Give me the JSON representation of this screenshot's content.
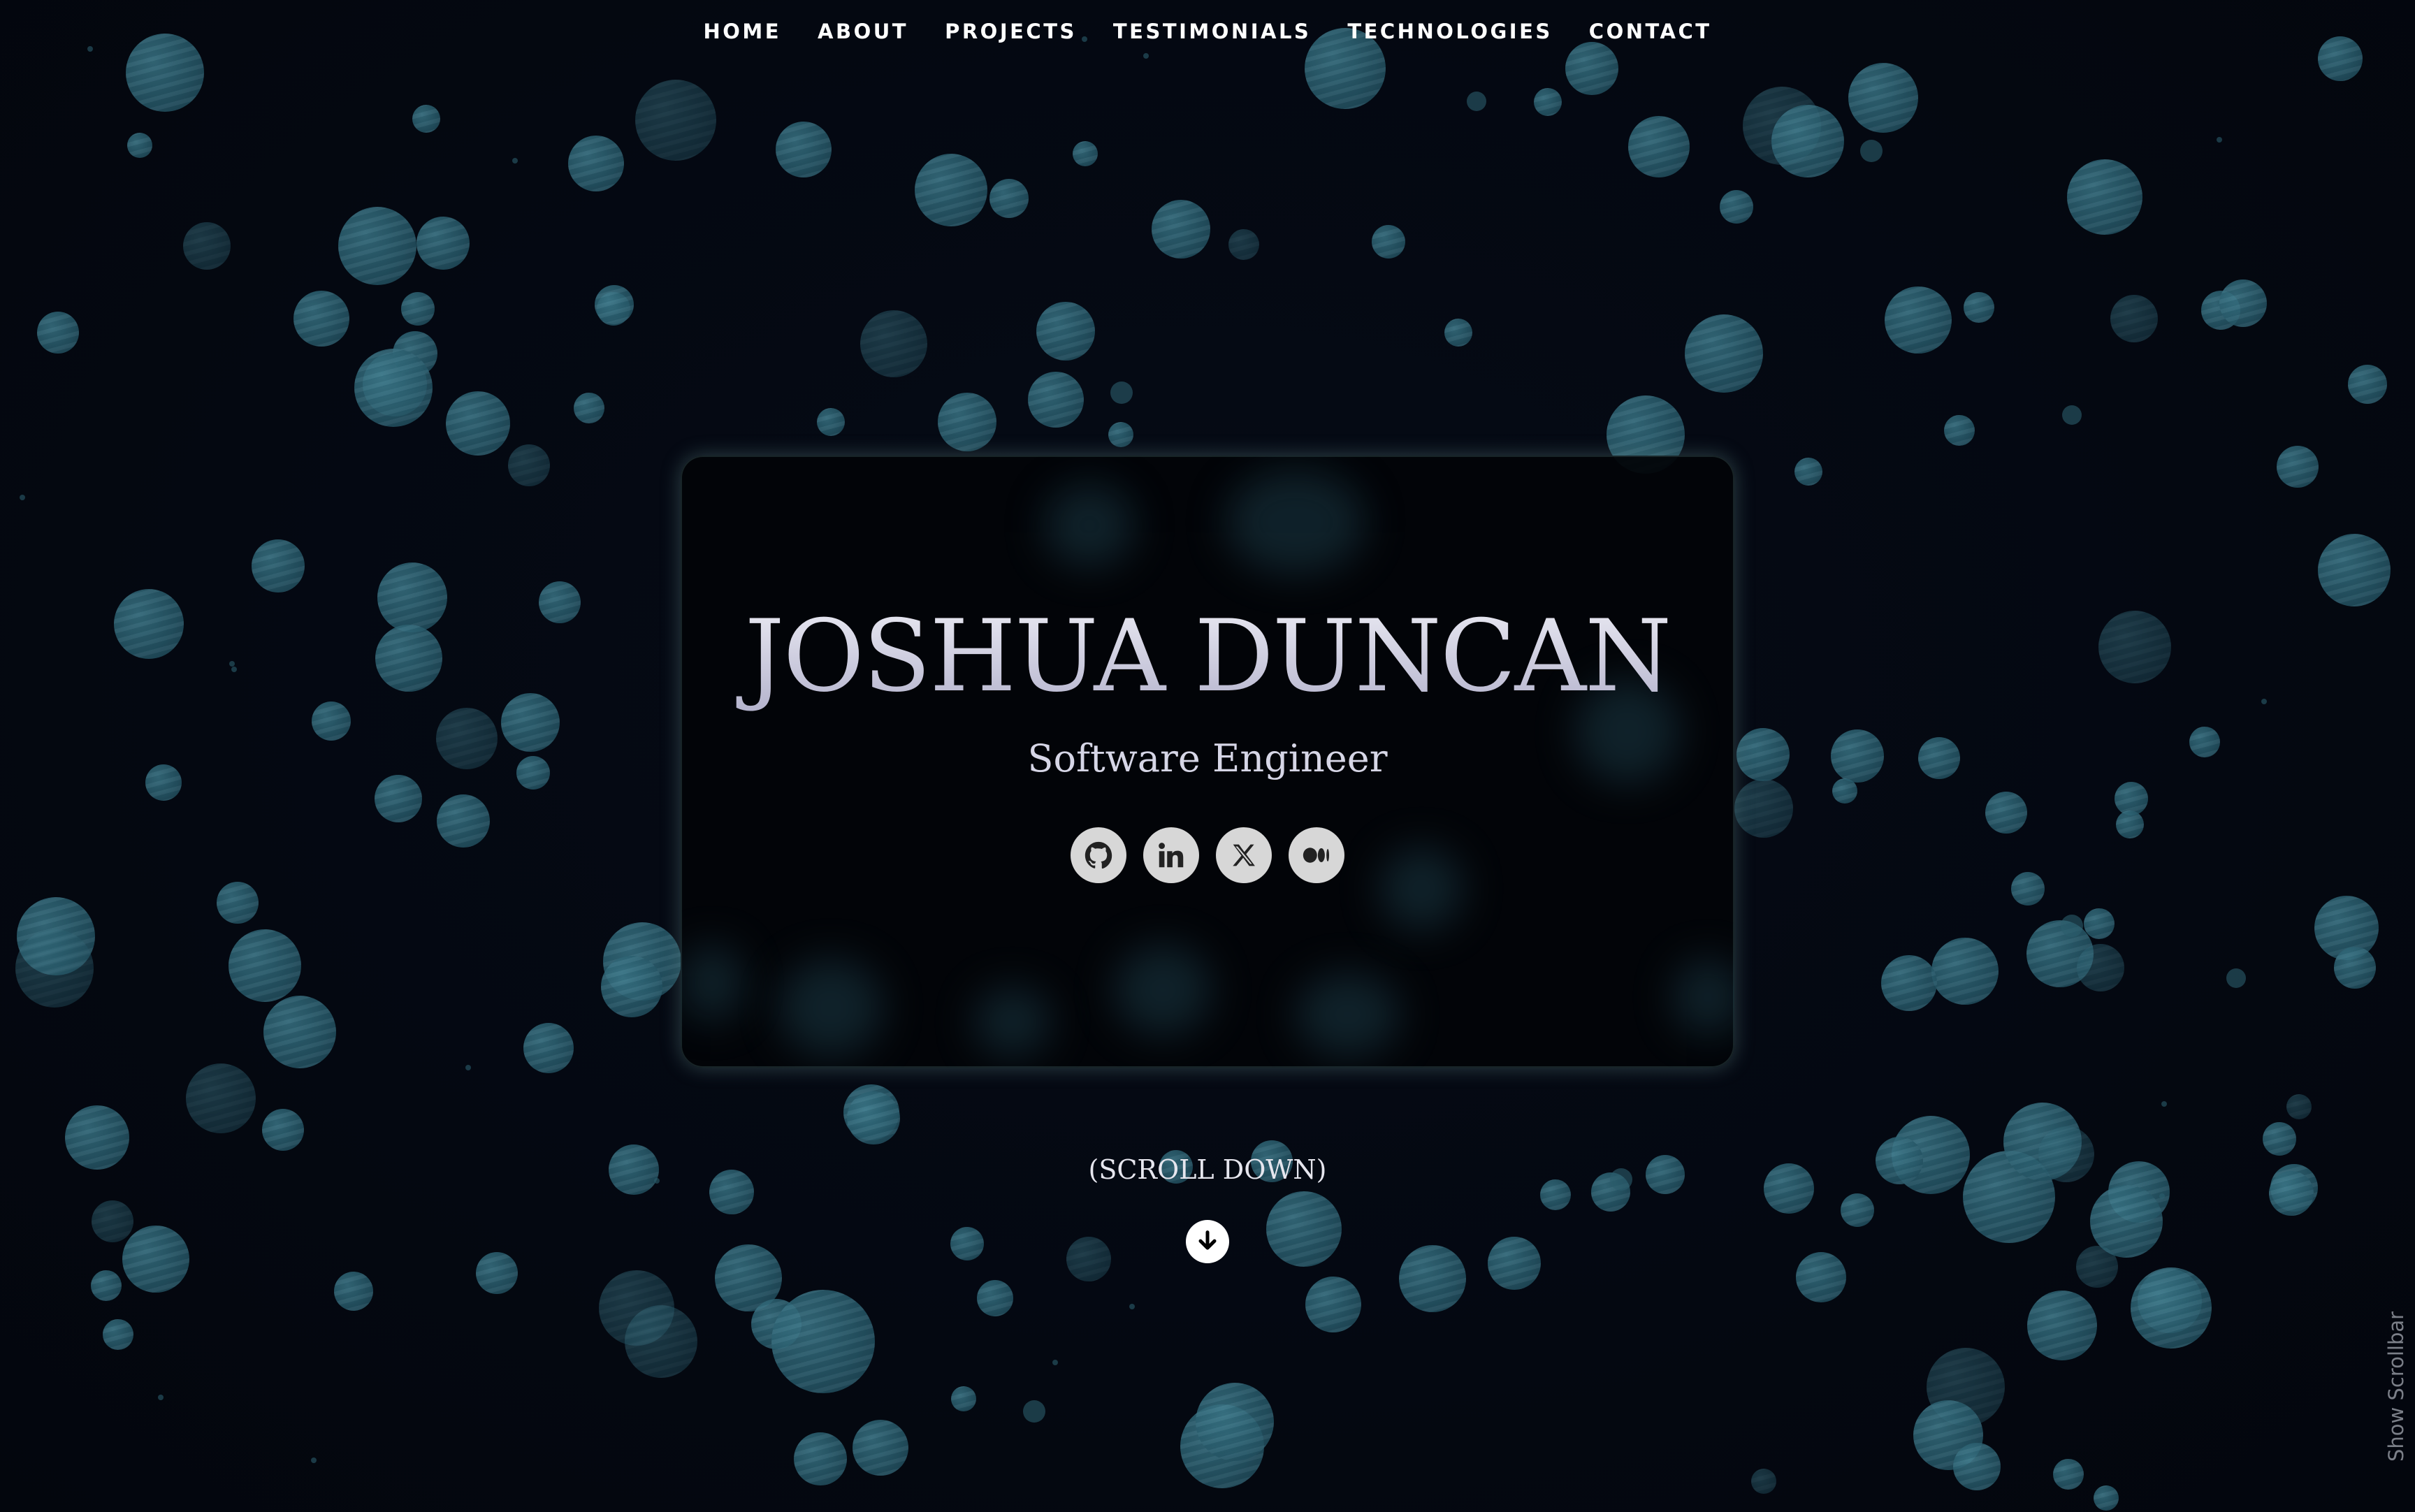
{
  "nav": {
    "items": [
      {
        "label": "HOME"
      },
      {
        "label": "ABOUT"
      },
      {
        "label": "PROJECTS"
      },
      {
        "label": "TESTIMONIALS"
      },
      {
        "label": "TECHNOLOGIES"
      },
      {
        "label": "CONTACT"
      }
    ]
  },
  "hero": {
    "name": "JOSHUA DUNCAN",
    "role": "Software Engineer",
    "socials": [
      {
        "icon": "github-icon"
      },
      {
        "icon": "linkedin-icon"
      },
      {
        "icon": "x-icon"
      },
      {
        "icon": "medium-icon"
      }
    ]
  },
  "scroll": {
    "label": "(SCROLL DOWN)",
    "icon": "arrow-down-icon"
  },
  "scrollbar_toggle": {
    "label": "Show Scrollbar"
  },
  "colors": {
    "background": "#040811",
    "bubble": "#2a5f70",
    "card": "#020408",
    "social_button": "#d7d7d7"
  }
}
